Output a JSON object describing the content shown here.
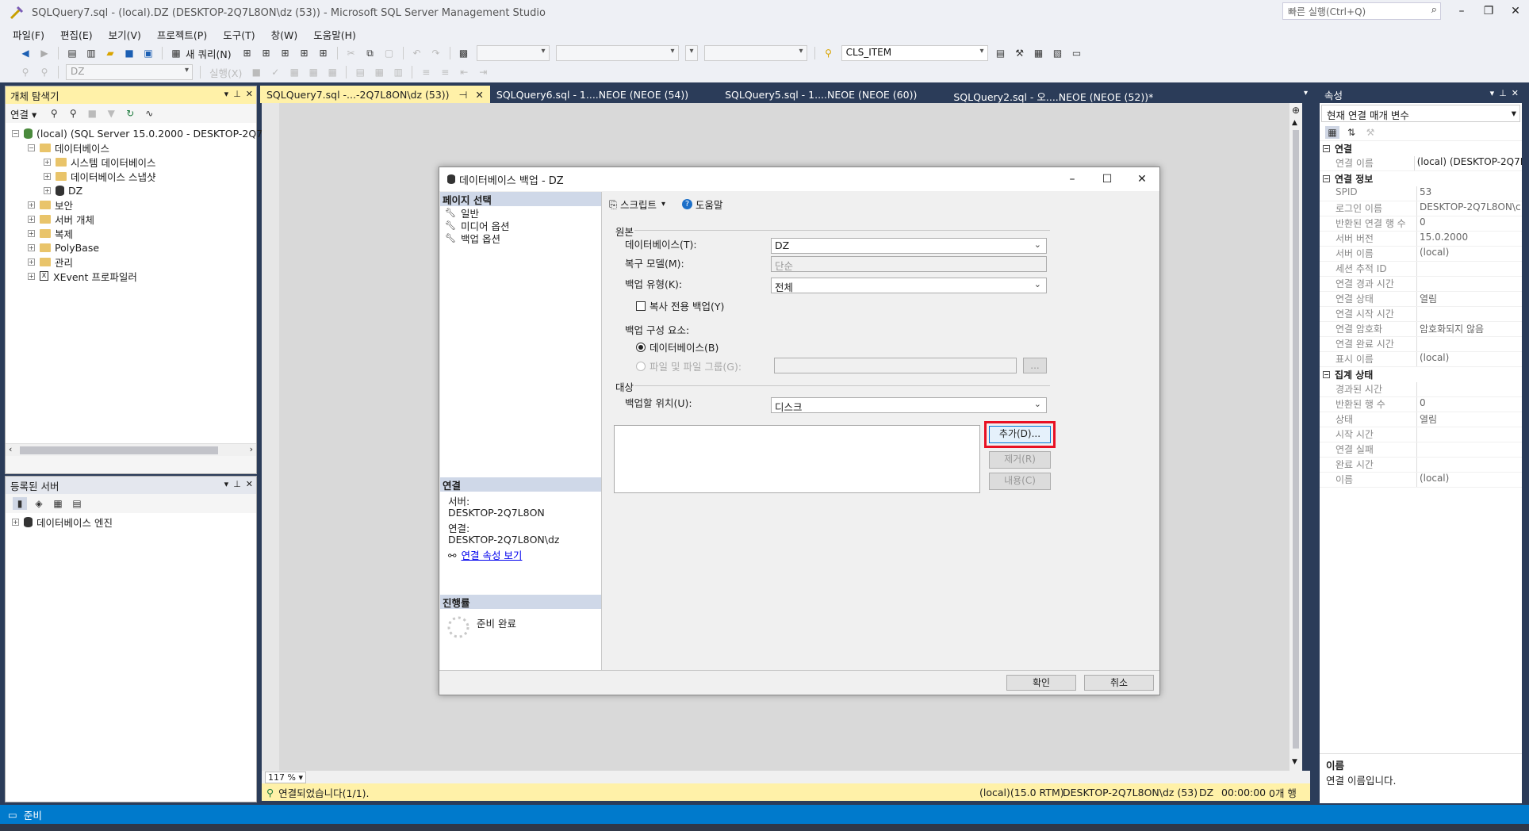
{
  "window": {
    "title": "SQLQuery7.sql - (local).DZ (DESKTOP-2Q7L8ON\\dz (53)) - Microsoft SQL Server Management Studio",
    "quick_launch": "빠른 실행(Ctrl+Q)"
  },
  "menu": [
    "파일(F)",
    "편집(E)",
    "보기(V)",
    "프로젝트(P)",
    "도구(T)",
    "창(W)",
    "도움말(H)"
  ],
  "toolbar": {
    "new_query": "새 쿼리(N)",
    "item_combo": "CLS_ITEM",
    "db_combo": "DZ",
    "execute": "실행(X)"
  },
  "object_explorer": {
    "title": "개체 탐색기",
    "connect": "연결 ▾",
    "server": "(local) (SQL Server 15.0.2000 - DESKTOP-2Q7L8O",
    "items": [
      "데이터베이스",
      "시스템 데이터베이스",
      "데이터베이스 스냅샷",
      "DZ",
      "보안",
      "서버 개체",
      "복제",
      "PolyBase",
      "관리",
      "XEvent 프로파일러"
    ]
  },
  "registered_servers": {
    "title": "등록된 서버",
    "item": "데이터베이스 엔진"
  },
  "tabs": [
    {
      "label": "SQLQuery7.sql -...-2Q7L8ON\\dz (53))"
    },
    {
      "label": "SQLQuery6.sql - 1....NEOE (NEOE (54))"
    },
    {
      "label": "SQLQuery5.sql - 1....NEOE (NEOE (60))"
    },
    {
      "label": "SQLQuery2.sql - 오....NEOE (NEOE (52))*"
    }
  ],
  "dialog": {
    "title": "데이터베이스 백업 - DZ",
    "page_select": "페이지 선택",
    "pages": [
      "일반",
      "미디어 옵션",
      "백업 옵션"
    ],
    "script": "스크립트",
    "help": "도움말",
    "source": "원본",
    "database_label": "데이터베이스(T):",
    "database_value": "DZ",
    "recovery_label": "복구 모델(M):",
    "recovery_value": "단순",
    "backup_type_label": "백업 유형(K):",
    "backup_type_value": "전체",
    "copy_only": "복사 전용 백업(Y)",
    "component_label": "백업 구성 요소:",
    "component_db": "데이터베이스(B)",
    "component_files": "파일 및 파일 그룹(G):",
    "browse": "...",
    "destination": "대상",
    "backup_to_label": "백업할 위치(U):",
    "backup_to_value": "디스크",
    "add": "추가(D)...",
    "remove": "제거(R)",
    "contents": "내용(C)",
    "connection": "연결",
    "server_label": "서버:",
    "server_value": "DESKTOP-2Q7L8ON",
    "conn_label": "연결:",
    "conn_value": "DESKTOP-2Q7L8ON\\dz",
    "view_conn": "연결 속성 보기",
    "progress": "진행률",
    "ready": "준비 완료",
    "ok": "확인",
    "cancel": "취소",
    "highlight_color": "#e81123"
  },
  "editor": {
    "zoom": "117 %"
  },
  "query_status": {
    "message": "연결되었습니다(1/1).",
    "server": "(local)(15.0 RTM)",
    "user": "DESKTOP-2Q7L8ON\\dz (53)",
    "db": "DZ",
    "time": "00:00:00",
    "rows": "0개 행"
  },
  "properties": {
    "title": "속성",
    "selector": "현재 연결 매개 변수",
    "cat1": "연결",
    "cat2": "연결 정보",
    "cat3": "집계 상태",
    "rows1": [
      {
        "k": "연결 이름",
        "v": "(local) (DESKTOP-2Q7L"
      }
    ],
    "rows2": [
      {
        "k": "SPID",
        "v": "53"
      },
      {
        "k": "로그인 이름",
        "v": "DESKTOP-2Q7L8ON\\c"
      },
      {
        "k": "반환된 연결 행 수",
        "v": "0"
      },
      {
        "k": "서버 버전",
        "v": "15.0.2000"
      },
      {
        "k": "서버 이름",
        "v": "(local)"
      },
      {
        "k": "세션 추적 ID",
        "v": ""
      },
      {
        "k": "연결 경과 시간",
        "v": ""
      },
      {
        "k": "연결 상태",
        "v": "열림"
      },
      {
        "k": "연결 시작 시간",
        "v": ""
      },
      {
        "k": "연결 암호화",
        "v": "암호화되지 않음"
      },
      {
        "k": "연결 완료 시간",
        "v": ""
      },
      {
        "k": "표시 이름",
        "v": "(local)"
      }
    ],
    "rows3": [
      {
        "k": "경과된 시간",
        "v": ""
      },
      {
        "k": "반환된 행 수",
        "v": "0"
      },
      {
        "k": "상태",
        "v": "열림"
      },
      {
        "k": "시작 시간",
        "v": ""
      },
      {
        "k": "연결 실패",
        "v": ""
      },
      {
        "k": "완료 시간",
        "v": ""
      },
      {
        "k": "이름",
        "v": "(local)"
      }
    ],
    "desc_title": "이름",
    "desc_text": "연결 이름입니다."
  },
  "status": {
    "ready": "준비"
  }
}
